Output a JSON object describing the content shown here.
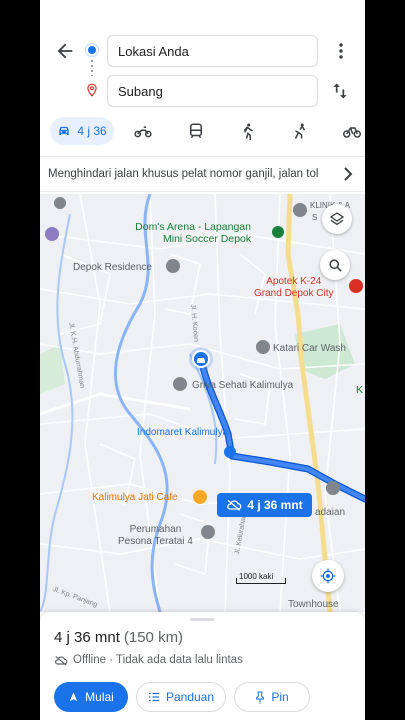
{
  "search": {
    "origin": "Lokasi Anda",
    "destination": "Subang"
  },
  "modes": {
    "drive_time": "4 j 36"
  },
  "notice": {
    "text": "Menghindari jalan khusus pelat nomor ganjil, jalan tol"
  },
  "map": {
    "labels": {
      "doms_arena_line1": "Dom's Arena - Lapangan",
      "doms_arena_line2": "Mini Soccer Depok",
      "depok_residence": "Depok Residence",
      "apotek_line1": "Apotek K-24",
      "apotek_line2": "Grand Depok City",
      "katari": "Katari Car Wash",
      "griya": "Griya Sehati Kalimulya",
      "indomaret": "Indomaret Kalimulya",
      "kalimulya_cafe": "Kalimulya Jati Cafe",
      "perumahan_line1": "Perumahan",
      "perumahan_line2": "Pesona Teratai 4",
      "townhouse": "Townhouse",
      "klinik": "KLINIK & A",
      "klinik2": "S",
      "adaian": "adaian",
      "street_aldurrahman": "Jl. K.H. Abdurrahman",
      "street_kocen": "Jl. H. Kocen",
      "street_kelurahan": "Jl. Kelurahan",
      "street_kp": "Jl. Kp. Panjang",
      "k_edge": "K"
    },
    "route_chip": "4 j 36 mnt",
    "scale": "1000 kaki"
  },
  "sheet": {
    "time": "4 j 36 mnt",
    "distance": "(150 km)",
    "status": "Offline · Tidak ada data lalu lintas",
    "start_label": "Mulai",
    "guide_label": "Panduan",
    "pin_label": "Pin"
  },
  "colors": {
    "accent": "#1a73e8",
    "route": "#1a73e8",
    "destination_pin": "#d93025"
  }
}
